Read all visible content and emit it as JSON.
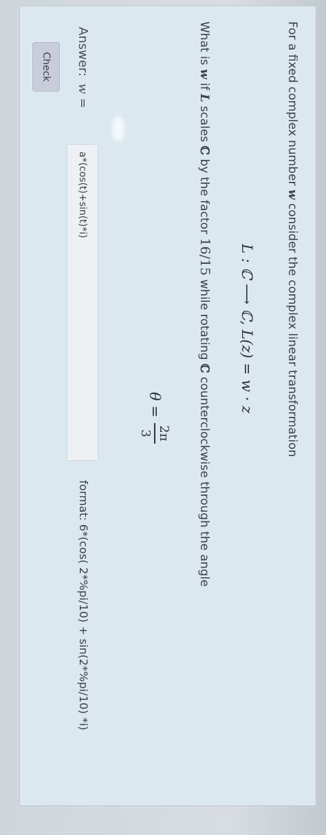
{
  "question": {
    "intro_prefix": "For a fixed complex number ",
    "w_symbol": "w",
    "intro_suffix": " consider the complex linear transformation",
    "transformation": "L : ℂ ⟶ ℂ,   L(z) = w · z",
    "q_prefix": "What is ",
    "q_w": "w",
    "q_if": " if ",
    "q_L": "L",
    "q_scales": " scales ",
    "q_C1": "ℂ",
    "q_by": " by the factor ",
    "factor": "16/15",
    "q_while": " while rotating ",
    "q_C2": "ℂ",
    "q_suffix": " counterclockwise through the angle",
    "theta_lhs": "θ =",
    "theta_num": "2π",
    "theta_den": "3"
  },
  "answer": {
    "label": "Answer:",
    "var": "w =",
    "value": "a*(cos(t)+sin(t)*i)",
    "format_hint": "format: 6*(cos( 2*%pi/10) + sin(2*%pi/10) *i)"
  },
  "buttons": {
    "check": "Check"
  }
}
